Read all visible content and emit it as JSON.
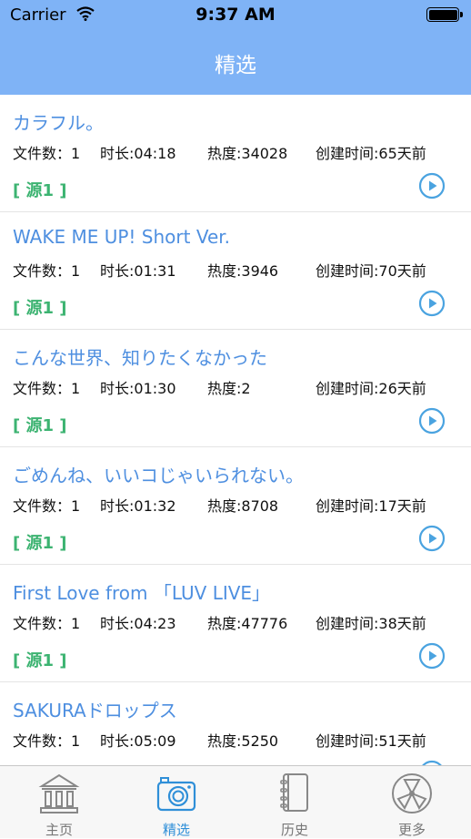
{
  "status_bar": {
    "carrier": "Carrier",
    "time": "9:37 AM"
  },
  "nav": {
    "title": "精选"
  },
  "items": [
    {
      "title": "カラフル。",
      "files": "文件数：1",
      "duration": "时长:04:18",
      "heat": "热度:34028",
      "created": "创建时间:65天前",
      "source": "[ 源1 ]"
    },
    {
      "title": "WAKE ME UP! Short Ver.",
      "files": "文件数：1",
      "duration": "时长:01:31",
      "heat": "热度:3946",
      "created": "创建时间:70天前",
      "source": "[ 源1 ]"
    },
    {
      "title": "こんな世界、知りたくなかった",
      "files": "文件数：1",
      "duration": "时长:01:30",
      "heat": "热度:2",
      "created": "创建时间:26天前",
      "source": "[ 源1 ]"
    },
    {
      "title": "ごめんね、いいコじゃいられない。",
      "files": "文件数：1",
      "duration": "时长:01:32",
      "heat": "热度:8708",
      "created": "创建时间:17天前",
      "source": "[ 源1 ]"
    },
    {
      "title": "First Love from 「LUV LIVE」",
      "files": "文件数：1",
      "duration": "时长:04:23",
      "heat": "热度:47776",
      "created": "创建时间:38天前",
      "source": "[ 源1 ]"
    },
    {
      "title": "SAKURAドロップス",
      "files": "文件数：1",
      "duration": "时长:05:09",
      "heat": "热度:5250",
      "created": "创建时间:51天前",
      "source": ""
    }
  ],
  "tabs": [
    {
      "label": "主页",
      "icon": "museum-icon",
      "active": false
    },
    {
      "label": "精选",
      "icon": "camera-icon",
      "active": true
    },
    {
      "label": "历史",
      "icon": "notebook-icon",
      "active": false
    },
    {
      "label": "更多",
      "icon": "film-reel-icon",
      "active": false
    }
  ],
  "colors": {
    "header": "#7fb3f6",
    "title_text": "#4e8fe0",
    "source_text": "#3cb371",
    "play": "#4aa3e0",
    "tab_active": "#2f8fd8"
  }
}
